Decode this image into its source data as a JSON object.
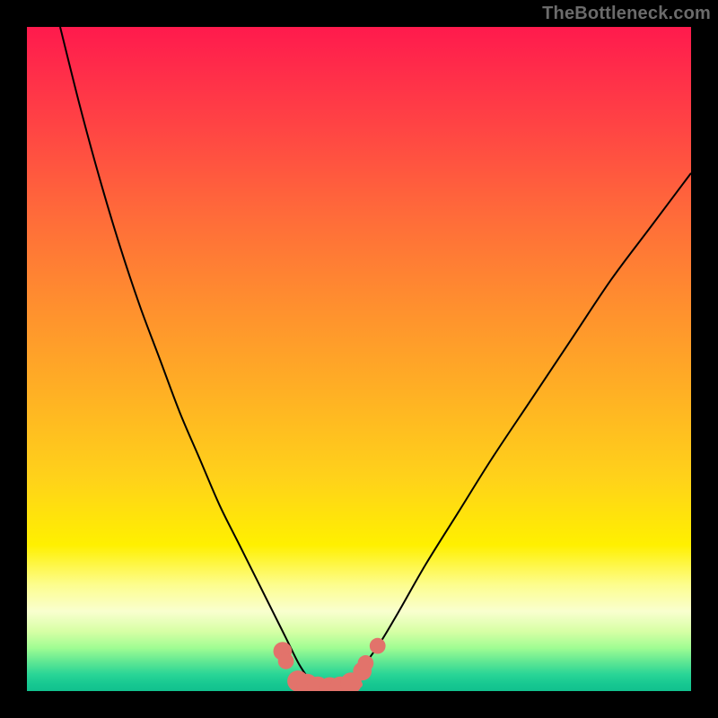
{
  "watermark": "TheBottleneck.com",
  "chart_data": {
    "type": "line",
    "title": "",
    "xlabel": "",
    "ylabel": "",
    "xlim": [
      0,
      100
    ],
    "ylim": [
      0,
      100
    ],
    "series": [
      {
        "name": "left-curve",
        "x": [
          5,
          8,
          11,
          14,
          17,
          20,
          23,
          26,
          29,
          32,
          35,
          37,
          39,
          41,
          43
        ],
        "values": [
          100,
          88,
          77,
          67,
          58,
          50,
          42,
          35,
          28,
          22,
          16,
          12,
          8,
          4,
          1
        ]
      },
      {
        "name": "right-curve",
        "x": [
          48,
          50,
          53,
          56,
          60,
          65,
          70,
          76,
          82,
          88,
          94,
          100
        ],
        "values": [
          1,
          3,
          7,
          12,
          19,
          27,
          35,
          44,
          53,
          62,
          70,
          78
        ]
      },
      {
        "name": "valley-floor",
        "x": [
          41,
          44,
          47,
          50
        ],
        "values": [
          1,
          0,
          0,
          1
        ]
      }
    ],
    "markers": [
      {
        "x": 38.5,
        "y": 6.0,
        "r": 1.4
      },
      {
        "x": 39.0,
        "y": 4.5,
        "r": 1.2
      },
      {
        "x": 40.8,
        "y": 1.5,
        "r": 1.6
      },
      {
        "x": 42.2,
        "y": 1.0,
        "r": 1.6
      },
      {
        "x": 43.8,
        "y": 0.6,
        "r": 1.6
      },
      {
        "x": 45.6,
        "y": 0.5,
        "r": 1.6
      },
      {
        "x": 47.2,
        "y": 0.6,
        "r": 1.6
      },
      {
        "x": 48.8,
        "y": 1.2,
        "r": 1.6
      },
      {
        "x": 50.5,
        "y": 3.0,
        "r": 1.4
      },
      {
        "x": 51.0,
        "y": 4.2,
        "r": 1.2
      },
      {
        "x": 52.8,
        "y": 6.8,
        "r": 1.2
      }
    ],
    "colors": {
      "curve": "#000000",
      "marker": "#e2736b"
    }
  }
}
